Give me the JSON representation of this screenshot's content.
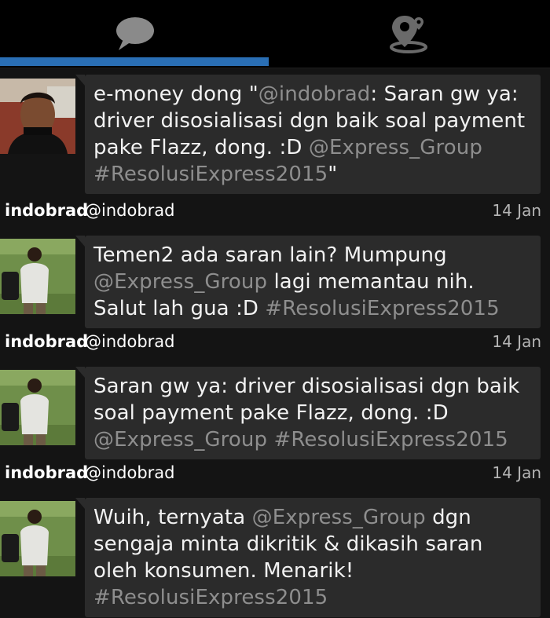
{
  "tabs": [
    {
      "icon": "chat-bubble-icon",
      "active": true
    },
    {
      "icon": "location-pin-icon",
      "active": false
    }
  ],
  "colors": {
    "accent": "#2a6fb5",
    "bubble": "#2b2b2b",
    "muted_link": "#8e8e8e"
  },
  "feed": {
    "first_tweet": {
      "segments": [
        {
          "t": "e-money dong \"",
          "k": "text"
        },
        {
          "t": "@indobrad",
          "k": "mention"
        },
        {
          "t": ": Saran gw ya: driver disosialisasi dgn baik soal payment pake Flazz, dong. :D ",
          "k": "text"
        },
        {
          "t": "@Express_Group",
          "k": "mention"
        },
        {
          "t": " ",
          "k": "text"
        },
        {
          "t": "#ResolusiExpress2015",
          "k": "hashtag"
        },
        {
          "t": "\"",
          "k": "text"
        }
      ]
    },
    "tweets": [
      {
        "name": "indobrad",
        "handle": "@indobrad",
        "time": "14 Jan",
        "segments": [
          {
            "t": "Temen2 ada saran lain? Mumpung ",
            "k": "text"
          },
          {
            "t": "@Express_Group",
            "k": "mention"
          },
          {
            "t": " lagi memantau nih. Salut lah gua :D ",
            "k": "text"
          },
          {
            "t": "#ResolusiExpress2015",
            "k": "hashtag"
          }
        ]
      },
      {
        "name": "indobrad",
        "handle": "@indobrad",
        "time": "14 Jan",
        "segments": [
          {
            "t": "Saran gw ya: driver disosialisasi dgn baik soal payment pake Flazz, dong. :D ",
            "k": "text"
          },
          {
            "t": "@Express_Group",
            "k": "mention"
          },
          {
            "t": " ",
            "k": "text"
          },
          {
            "t": "#ResolusiExpress2015",
            "k": "hashtag"
          }
        ]
      },
      {
        "name": "indobrad",
        "handle": "@indobrad",
        "time": "14 Jan",
        "segments": [
          {
            "t": "Wuih, ternyata ",
            "k": "text"
          },
          {
            "t": "@Express_Group",
            "k": "mention"
          },
          {
            "t": " dgn sengaja minta dikritik & dikasih saran oleh konsumen. Menarik! ",
            "k": "text"
          },
          {
            "t": "#ResolusiExpress2015",
            "k": "hashtag"
          }
        ]
      }
    ]
  }
}
